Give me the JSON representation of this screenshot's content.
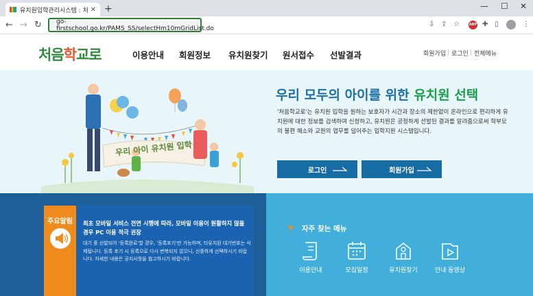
{
  "browser": {
    "tab_title": "유치원입학관리시스템 : 처음학교로",
    "tab_title_short": "유치원입학관리시스템 : 처음학",
    "new_tab": "+",
    "url": "go-firstschool.go.kr/PAMS_SS/selectHm10mGridList.do",
    "back": "←",
    "forward": "→",
    "reload": "↻",
    "abp_label": "ABP",
    "window_controls": {
      "minimize": "—",
      "maximize": "☐",
      "close": "✕"
    },
    "icons": [
      "download-icon",
      "share-icon",
      "star-icon",
      "extensions-icon",
      "sidebar-icon",
      "menu-icon"
    ]
  },
  "site": {
    "logo_pre": "처음",
    "logo_hak": "학",
    "logo_post": "교로",
    "nav": [
      "이용안내",
      "회원정보",
      "유치원찾기",
      "원서접수",
      "선발결과"
    ],
    "util": [
      "회원가입",
      "로그인",
      "전체메뉴"
    ]
  },
  "hero": {
    "title_pre": "우리 모두의 아이를 위한 ",
    "title_hl": "유치원 선택",
    "desc": "'처음학교로'는 유치원 입학을 원하는 보호자가 시간과 장소의 제한없이 온라인으로 편리하게 유치원에 대한 정보를 검색하여 신청하고, 유치원은 공정하게 선발된 결과를 알려줌으로써 학부모의 불편 해소와 교원의 업무를 덜어주는 입학지원 시스템입니다.",
    "banner_text": "우리 아이 유치원 입학",
    "buttons": {
      "login": "로그인",
      "signup": "회원가입"
    }
  },
  "notice": {
    "label": "주요알림",
    "headline": "최초 모바일 서비스 전면 시행에 따라, 모바일 이용이 원활하지 않을 경우 PC 이용 적극 권장",
    "body": "대기 중 선발되어 '등록완료'할 경우, '등록포기'만 가능하며, 타유치원 대기번호는 삭제됩니다. 등록 포기 시 등록으로 다시 변복되지 않으니, 신중하게 선택하시기 바랍니다. 자세한 내용은 공지사항을 참고하시기 바랍니다."
  },
  "frequent": {
    "title": "자주 찾는 메뉴",
    "items": [
      {
        "label": "이용안내",
        "icon": "scroll-icon"
      },
      {
        "label": "모집일정",
        "icon": "calendar-icon"
      },
      {
        "label": "유치원찾기",
        "icon": "school-icon"
      },
      {
        "label": "안내 동영상",
        "icon": "video-icon"
      }
    ]
  },
  "colors": {
    "brand_green": "#2f8a3e",
    "brand_blue": "#176da3",
    "notice_orange": "#f08c1e",
    "notice_navy": "#1e5f9a",
    "freq_blue": "#41aedc",
    "hero_bg": "#e8f5f9"
  }
}
